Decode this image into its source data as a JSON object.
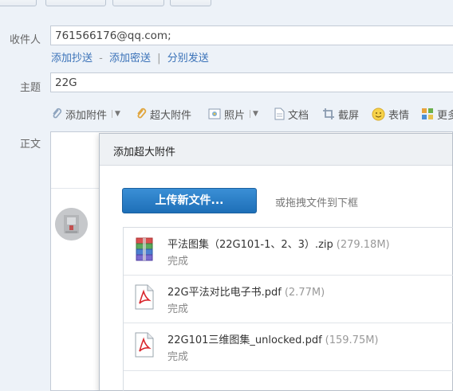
{
  "form": {
    "to_label": "收件人",
    "to_value": "761566176@qq.com;",
    "add_cc": "添加抄送",
    "link_dash": "-",
    "add_bcc": "添加密送",
    "link_bar": "|",
    "send_separately": "分别发送",
    "subject_label": "主题",
    "subject_value": "22G",
    "body_label": "正文"
  },
  "toolbar": {
    "attach": "添加附件",
    "big_attach": "超大附件",
    "photo": "照片",
    "doc": "文档",
    "screenshot": "截屏",
    "emoji": "表情",
    "more": "更多"
  },
  "dialog": {
    "title": "添加超大附件",
    "upload_button": "上传新文件...",
    "drag_hint": "或拖拽文件到下框",
    "files": [
      {
        "name": "平法图集（22G101-1、2、3）.zip",
        "size": "(279.18M)",
        "status": "完成",
        "type": "zip"
      },
      {
        "name": "22G平法对比电子书.pdf",
        "size": "(2.77M)",
        "status": "完成",
        "type": "pdf"
      },
      {
        "name": "22G101三维图集_unlocked.pdf",
        "size": "(159.75M)",
        "status": "完成",
        "type": "pdf"
      }
    ]
  },
  "colors": {
    "link": "#3a72b8",
    "button": "#1e6fb8",
    "pdf_red": "#d9262c"
  }
}
